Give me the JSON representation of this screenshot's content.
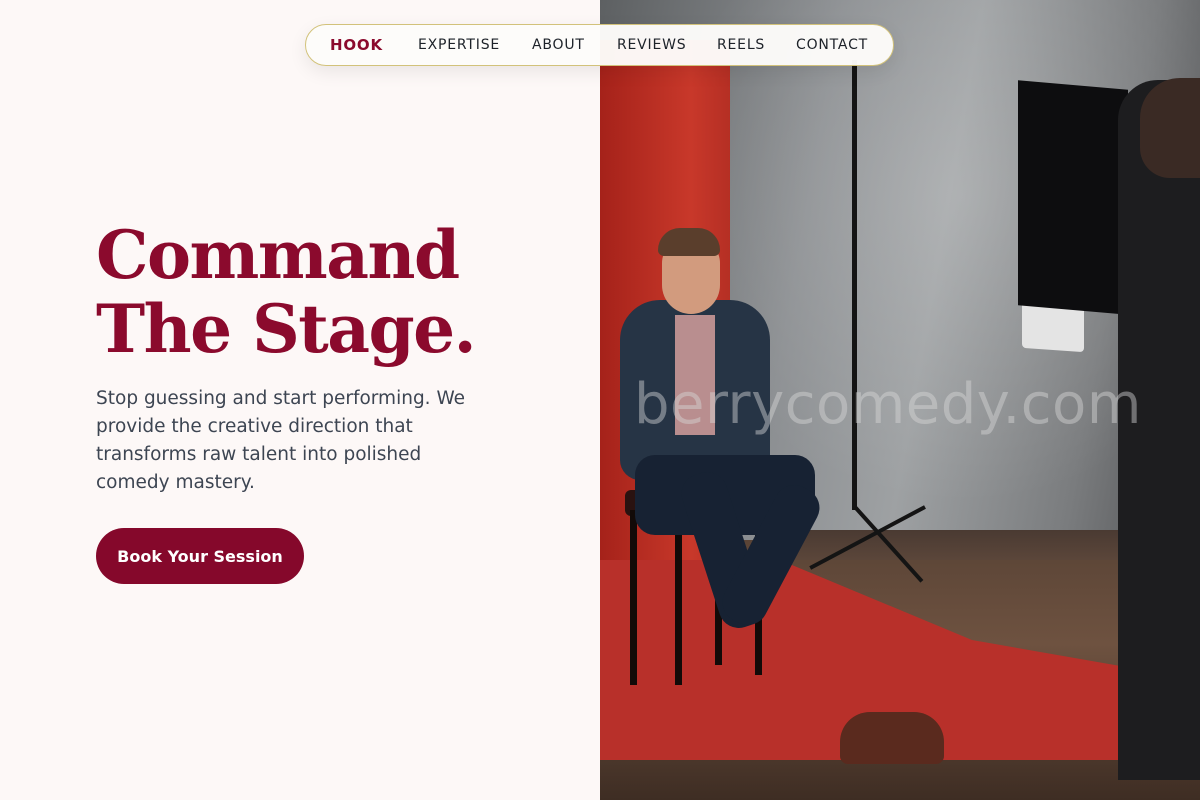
{
  "nav": {
    "items": [
      {
        "label": "HOOK",
        "active": true
      },
      {
        "label": "EXPERTISE",
        "active": false
      },
      {
        "label": "ABOUT",
        "active": false
      },
      {
        "label": "REVIEWS",
        "active": false
      },
      {
        "label": "REELS",
        "active": false
      },
      {
        "label": "CONTACT",
        "active": false
      }
    ]
  },
  "hero": {
    "headline_line1": "Command",
    "headline_line2": "The Stage.",
    "subtext": "Stop guessing and start performing. We provide the creative direction that transforms raw talent into polished comedy mastery.",
    "cta_label": "Book Your Session"
  },
  "photo": {
    "watermark": "berrycomedy.com"
  },
  "colors": {
    "brand": "#85082b",
    "background": "#fdf8f7",
    "text": "#3d4552",
    "nav_border": "#d2c27a"
  }
}
